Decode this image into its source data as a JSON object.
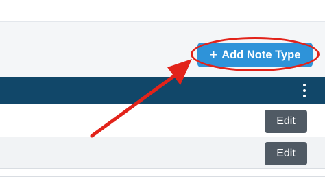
{
  "toolbar": {
    "add_button_label": "Add Note Type",
    "add_button_icon": "plus-icon"
  },
  "table": {
    "header_menu_icon": "kebab-menu-icon",
    "rows": [
      {
        "action_label": "Edit"
      },
      {
        "action_label": "Edit"
      }
    ]
  },
  "annotation": {
    "highlight_color": "#e2231a",
    "arrow_color": "#e2231a"
  },
  "colors": {
    "accent": "#2e93d9",
    "header": "#114769",
    "edit_button": "#505a64"
  }
}
